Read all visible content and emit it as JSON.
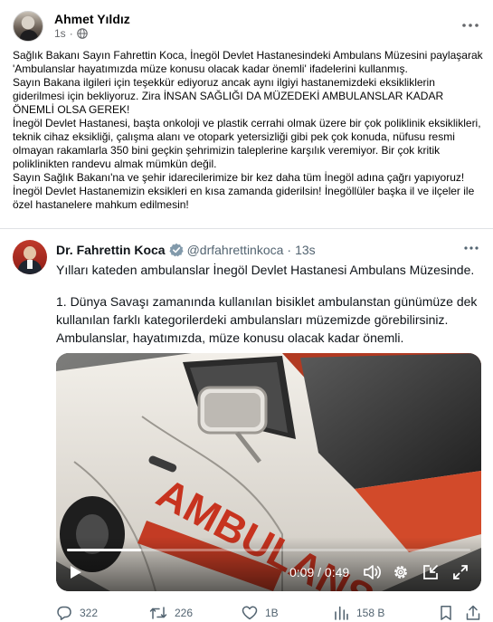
{
  "facebook_post": {
    "author": "Ahmet Yıldız",
    "time": "1s",
    "separator": "·",
    "more_icon": "more-dots-icon",
    "paragraphs": [
      "Sağlık Bakanı Sayın Fahrettin Koca, İnegöl Devlet Hastanesindeki Ambulans Müzesini paylaşarak 'Ambulanslar hayatımızda müze konusu olacak kadar önemli' ifadelerini kullanmış.",
      "Sayın Bakana ilgileri için teşekkür ediyoruz ancak aynı ilgiyi hastanemizdeki eksikliklerin giderilmesi için bekliyoruz. Zira İNSAN SAĞLIĞI DA MÜZEDEKİ AMBULANSLAR KADAR ÖNEMLİ OLSA GEREK!",
      "İnegöl Devlet Hastanesi, başta onkoloji ve plastik cerrahi olmak üzere bir çok poliklinik eksiklikleri, teknik cihaz eksikliği, çalışma alanı ve otopark yetersizliği gibi pek çok konuda, nüfusu resmi olmayan rakamlarla 350 bini geçkin şehrimizin taleplerine karşılık veremiyor. Bir çok kritik poliklinikten randevu almak mümkün değil.",
      "Sayın Sağlık Bakanı'na ve şehir idarecilerimize bir kez daha tüm İnegöl adına çağrı yapıyoruz! İnegöl Devlet Hastanemizin eksikleri en kısa zamanda giderilsin! İnegöllüler başka il ve ilçeler ile özel hastanelere mahkum edilmesin!"
    ]
  },
  "tweet": {
    "name": "Dr. Fahrettin Koca",
    "handle": "@drfahrettinkoca",
    "separator": "·",
    "time": "13s",
    "line1": "Yılları kateden ambulanslar İnegöl Devlet Hastanesi Ambulans Müzesinde.",
    "body": "1. Dünya Savaşı zamanında kullanılan bisiklet ambulanstan günümüze dek kullanılan farklı kategorilerdeki ambulansları müzemizde görebilirsiniz. Ambulanslar, hayatımızda, müze konusu olacak kadar önemli.",
    "video": {
      "vehicle_text": "AMBULANS",
      "current_time": "0:09",
      "time_separator": " / ",
      "duration": "0:49",
      "progress_fraction": 0.184
    },
    "actions": {
      "replies": "322",
      "retweets": "226",
      "likes": "1B",
      "views": "158 B"
    }
  },
  "colors": {
    "twitter_blue": "#1d9bf0",
    "muted_text": "#536471",
    "fb_muted": "#65676b"
  }
}
